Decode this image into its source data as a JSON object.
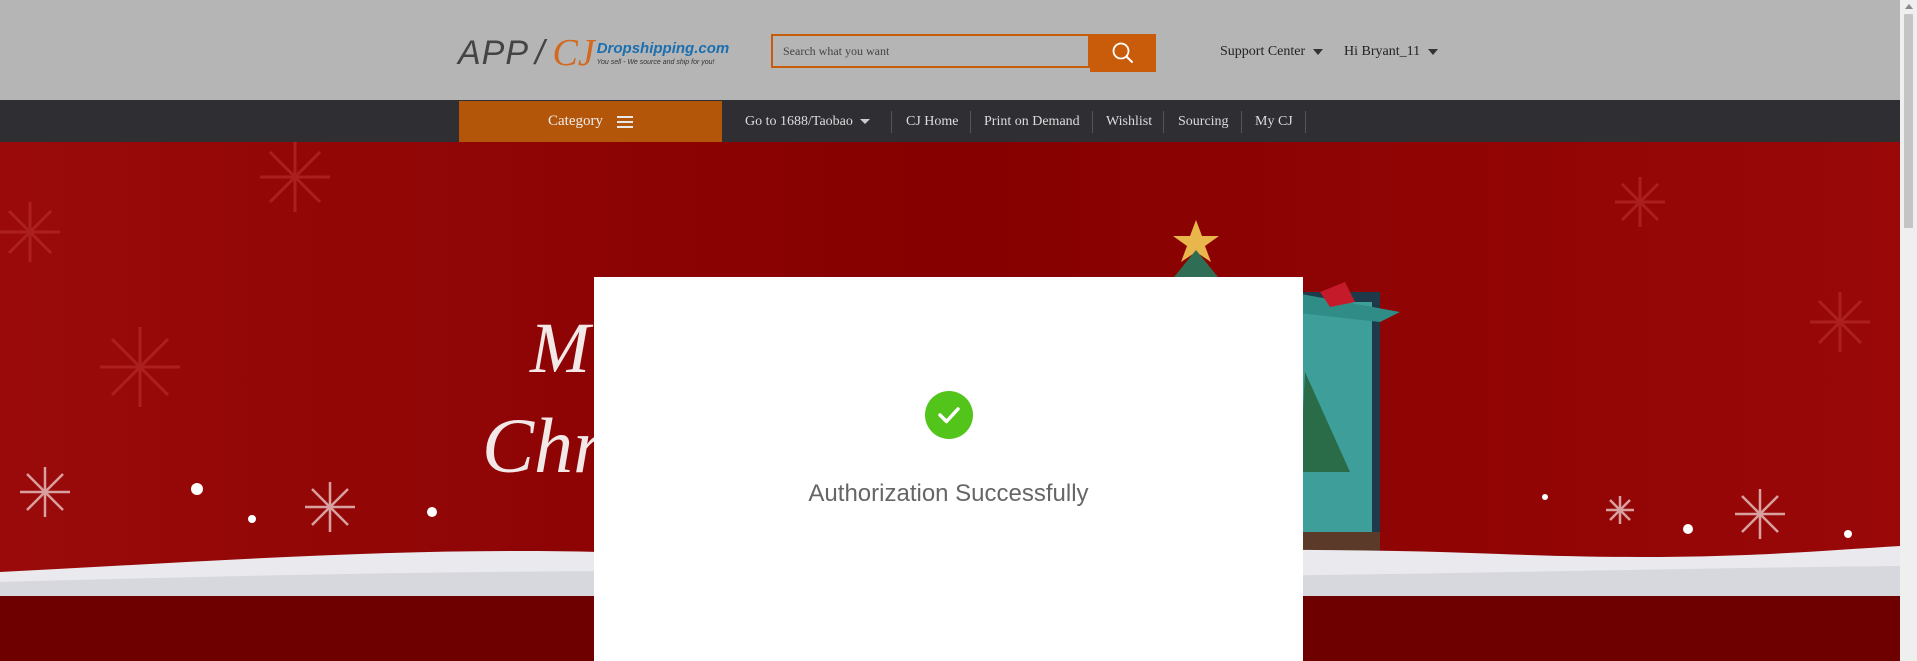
{
  "header": {
    "logo": {
      "app": "APP",
      "slash": "/",
      "cj": "CJ",
      "domain": "Dropshipping.com",
      "tagline": "You sell - We source and ship for you!"
    },
    "search": {
      "placeholder": "Search what you want",
      "icon": "search-icon"
    },
    "support_label": "Support Center",
    "user_label": "Hi Bryant_11"
  },
  "nav": {
    "category_label": "Category",
    "items": [
      {
        "label": "Go to 1688/Taobao"
      },
      {
        "label": "CJ Home"
      },
      {
        "label": "Print on Demand"
      },
      {
        "label": "Wishlist"
      },
      {
        "label": "Sourcing"
      },
      {
        "label": "My CJ"
      }
    ]
  },
  "modal": {
    "message": "Authorization Successfully",
    "icon": "check-circle-icon",
    "icon_color": "#52c41a"
  },
  "colors": {
    "accent": "#c95c0b",
    "nav_bg": "#2e2e33",
    "banner": "#8a0000"
  }
}
